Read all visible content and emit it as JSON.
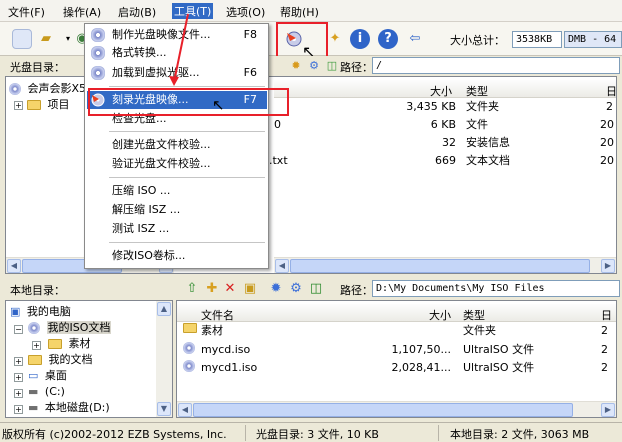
{
  "menubar": {
    "items": [
      "文件(F)",
      "操作(A)",
      "启动(B)",
      "工具(T)",
      "选项(O)",
      "帮助(H)"
    ]
  },
  "toolbar": {
    "total_size_label": "大小总计：",
    "total_size_value": "3538KB",
    "capacity_value": "DMB - 64"
  },
  "cd_pane": {
    "dir_label": "光盘目录：",
    "path_label": "路径：",
    "path_value": "/",
    "tree": [
      {
        "label": "会声会影X5"
      },
      {
        "label": "项目"
      }
    ],
    "columns": [
      "大小",
      "类型",
      "日"
    ],
    "rows": [
      {
        "name": "",
        "size": "3,435 KB",
        "type": "文件夹",
        "date": "2"
      },
      {
        "name": "0",
        "size": "6 KB",
        "type": "文件",
        "date": "20"
      },
      {
        "name": "",
        "size": "32",
        "type": "安装信息",
        "date": "20"
      },
      {
        "name": "1.txt",
        "size": "669",
        "type": "文本文档",
        "date": "20"
      }
    ]
  },
  "tools_menu": {
    "items": [
      {
        "label": "制作光盘映像文件...",
        "key": "F8",
        "icon": "disc-make-icon"
      },
      {
        "label": "格式转换...",
        "key": "",
        "icon": "convert-icon"
      },
      {
        "label": "加载到虚拟光驱...",
        "key": "F6",
        "icon": "virtual-drive-icon"
      },
      {
        "label": "刻录光盘映像...",
        "key": "F7",
        "icon": "burn-icon"
      },
      {
        "label": "检查光盘...",
        "key": ""
      },
      {
        "label": "创建光盘文件校验...",
        "key": ""
      },
      {
        "label": "验证光盘文件校验...",
        "key": ""
      },
      {
        "label": "压缩 ISO ...",
        "key": ""
      },
      {
        "label": "解压缩 ISZ ...",
        "key": ""
      },
      {
        "label": "测试 ISZ ...",
        "key": ""
      },
      {
        "label": "修改ISO卷标...",
        "key": ""
      }
    ]
  },
  "local_pane": {
    "dir_label": "本地目录：",
    "path_label": "路径：",
    "path_value": "D:\\My Documents\\My ISO Files",
    "tree": [
      {
        "label": "我的电脑"
      },
      {
        "label": "我的ISO文档"
      },
      {
        "label": "素材"
      },
      {
        "label": "我的文档"
      },
      {
        "label": "桌面"
      },
      {
        "label": "(C:)"
      },
      {
        "label": "本地磁盘(D:)"
      }
    ],
    "columns": [
      "文件名",
      "大小",
      "类型",
      "日"
    ],
    "rows": [
      {
        "name": "素材",
        "size": "",
        "type": "文件夹",
        "date": "2"
      },
      {
        "name": "mycd.iso",
        "size": "1,107,50...",
        "type": "UltraISO 文件",
        "date": "2"
      },
      {
        "name": "mycd1.iso",
        "size": "2,028,41...",
        "type": "UltraISO 文件",
        "date": "2"
      }
    ]
  },
  "status": {
    "copyright": "版权所有 (c)2002-2012 EZB Systems, Inc.",
    "cd_info": "光盘目录: 3 文件, 10 KB",
    "local_info": "本地目录: 2 文件, 3063 MB"
  },
  "colors": {
    "highlight": "#316ac5",
    "annotation_red": "#e8202a"
  }
}
